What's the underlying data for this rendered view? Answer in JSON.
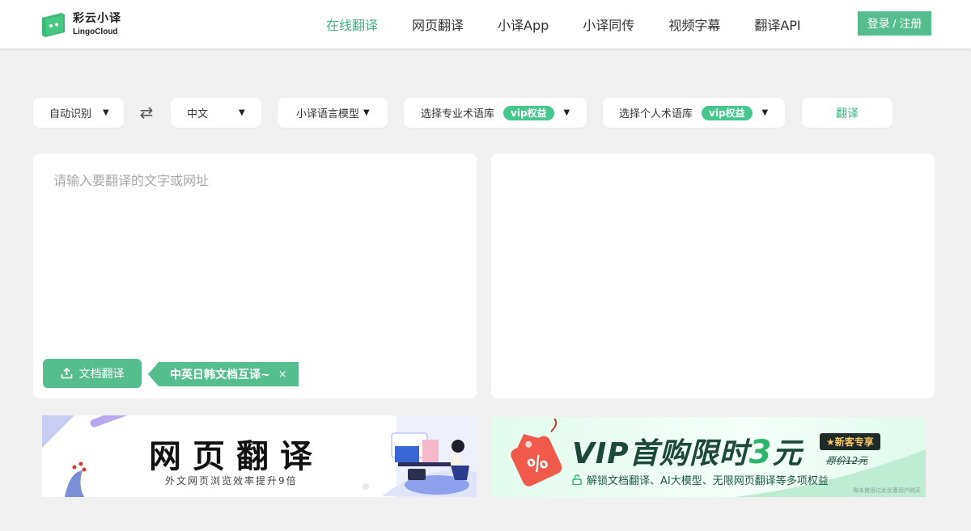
{
  "header": {
    "logo_cn": "彩云小译",
    "logo_en": "LingoCloud",
    "nav": [
      {
        "label": "在线翻译",
        "active": true
      },
      {
        "label": "网页翻译",
        "active": false
      },
      {
        "label": "小译App",
        "active": false
      },
      {
        "label": "小译同传",
        "active": false
      },
      {
        "label": "视频字幕",
        "active": false
      },
      {
        "label": "翻译API",
        "active": false
      }
    ],
    "login_label": "登录 / 注册"
  },
  "toolbar": {
    "source_lang": "自动识别",
    "target_lang": "中文",
    "model": "小译语言模型",
    "term_library": "选择专业术语库",
    "personal_library": "选择个人术语库",
    "vip_badge": "vip权益",
    "translate_label": "翻译",
    "caret": "▼",
    "swap_icon": "⇄"
  },
  "editor": {
    "placeholder": "请输入要翻译的文字或网址",
    "doc_translate_label": "文档翻译",
    "tip_text": "中英日韩文档互译~",
    "tip_close": "×"
  },
  "banners": {
    "web": {
      "title": "网页翻译",
      "subtitle": "外文网页浏览效率提升9倍"
    },
    "vip": {
      "title_prefix": "VIP首购限时",
      "title_num": "3",
      "title_suffix": "元",
      "tag": "★新客专享",
      "old_price": "原价12元",
      "subtitle": "解锁文档翻译、AI大模型、无限网页翻译等多项权益",
      "note": "需未使用过此优惠用户购买"
    }
  },
  "colors": {
    "accent": "#56be8e",
    "active_nav": "#3fb383",
    "background": "#f1f1f1"
  }
}
